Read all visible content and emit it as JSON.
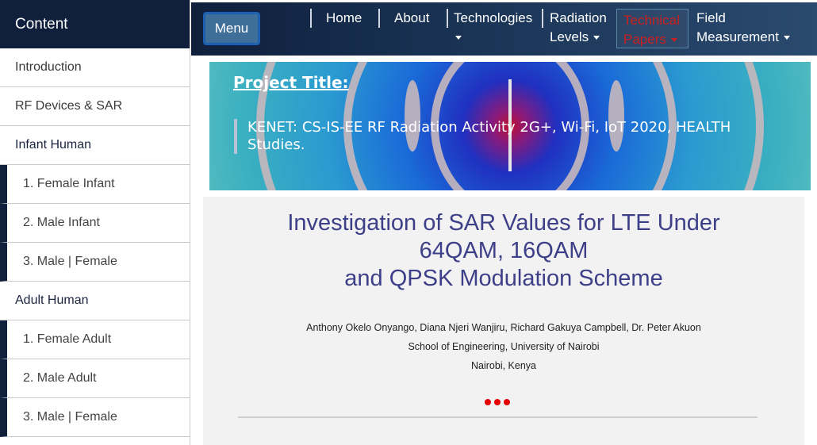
{
  "sidebar": {
    "header": "Content",
    "items": [
      {
        "label": "Introduction",
        "kind": "top"
      },
      {
        "label": "RF Devices & SAR",
        "kind": "top"
      },
      {
        "label": "Infant Human",
        "kind": "group"
      },
      {
        "label": "1. Female Infant",
        "kind": "sub"
      },
      {
        "label": "2. Male Infant",
        "kind": "sub"
      },
      {
        "label": "3. Male | Female",
        "kind": "sub"
      },
      {
        "label": "Adult Human",
        "kind": "group"
      },
      {
        "label": "1. Female Adult",
        "kind": "sub"
      },
      {
        "label": "2. Male Adult",
        "kind": "sub"
      },
      {
        "label": "3. Male | Female",
        "kind": "sub"
      }
    ]
  },
  "nav": {
    "menu_label": "Menu",
    "home": "Home",
    "about": "About",
    "technologies": "Technologies",
    "radiation_1": "Radiation",
    "radiation_2": "Levels",
    "tech_papers_1": "Technical",
    "tech_papers_2": "Papers",
    "field_1": "Field",
    "field_2": "Measurement",
    "active_color": "#cc1f1f"
  },
  "banner": {
    "title": "Project Title:",
    "description": "KENET: CS-IS-EE RF Radiation Activity 2G+, Wi-Fi, IoT 2020, HEALTH Studies."
  },
  "paper": {
    "title_line1": "Investigation of SAR Values for LTE Under",
    "title_line2": "64QAM, 16QAM",
    "title_line3": "and QPSK Modulation Scheme",
    "authors": "Anthony Okelo Onyango, Diana Njeri Wanjiru, Richard Gakuya Campbell, Dr. Peter Akuon",
    "school": "School of Engineering, University of Nairobi",
    "location": "Nairobi, Kenya"
  },
  "colors": {
    "sidebar_dark": "#0f1f3c",
    "title_color": "#3d3f88",
    "loading_dots": "#e60000"
  },
  "icons": [
    "caret-down-icon",
    "loading-dots-icon"
  ]
}
